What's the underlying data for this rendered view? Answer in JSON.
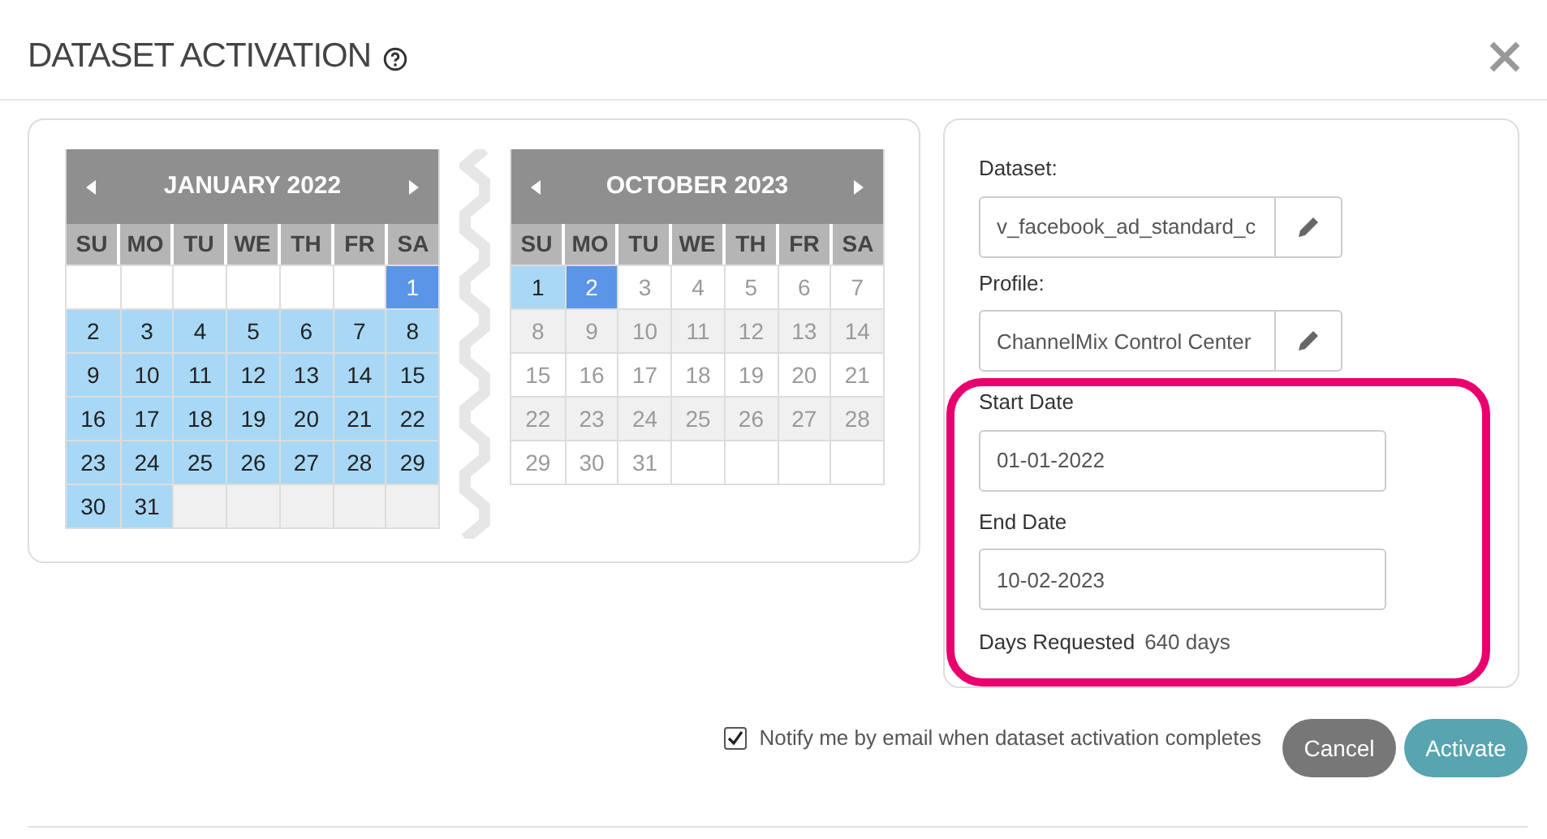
{
  "dialog": {
    "title": "DATASET ACTIVATION"
  },
  "calendars": [
    {
      "title": "JANUARY 2022",
      "weekdays": [
        "SU",
        "MO",
        "TU",
        "WE",
        "TH",
        "FR",
        "SA"
      ],
      "weeks": [
        [
          {
            "kind": "blank"
          },
          {
            "kind": "blank"
          },
          {
            "kind": "blank"
          },
          {
            "kind": "blank"
          },
          {
            "kind": "blank"
          },
          {
            "kind": "blank"
          },
          {
            "kind": "day",
            "day": "1",
            "selected": true,
            "in_range": false,
            "disabled": false
          }
        ],
        [
          {
            "kind": "day",
            "day": "2",
            "selected": false,
            "in_range": true,
            "disabled": false
          },
          {
            "kind": "day",
            "day": "3",
            "selected": false,
            "in_range": true,
            "disabled": false
          },
          {
            "kind": "day",
            "day": "4",
            "selected": false,
            "in_range": true,
            "disabled": false
          },
          {
            "kind": "day",
            "day": "5",
            "selected": false,
            "in_range": true,
            "disabled": false
          },
          {
            "kind": "day",
            "day": "6",
            "selected": false,
            "in_range": true,
            "disabled": false
          },
          {
            "kind": "day",
            "day": "7",
            "selected": false,
            "in_range": true,
            "disabled": false
          },
          {
            "kind": "day",
            "day": "8",
            "selected": false,
            "in_range": true,
            "disabled": false
          }
        ],
        [
          {
            "kind": "day",
            "day": "9",
            "selected": false,
            "in_range": true,
            "disabled": false
          },
          {
            "kind": "day",
            "day": "10",
            "selected": false,
            "in_range": true,
            "disabled": false
          },
          {
            "kind": "day",
            "day": "11",
            "selected": false,
            "in_range": true,
            "disabled": false
          },
          {
            "kind": "day",
            "day": "12",
            "selected": false,
            "in_range": true,
            "disabled": false
          },
          {
            "kind": "day",
            "day": "13",
            "selected": false,
            "in_range": true,
            "disabled": false
          },
          {
            "kind": "day",
            "day": "14",
            "selected": false,
            "in_range": true,
            "disabled": false
          },
          {
            "kind": "day",
            "day": "15",
            "selected": false,
            "in_range": true,
            "disabled": false
          }
        ],
        [
          {
            "kind": "day",
            "day": "16",
            "selected": false,
            "in_range": true,
            "disabled": false
          },
          {
            "kind": "day",
            "day": "17",
            "selected": false,
            "in_range": true,
            "disabled": false
          },
          {
            "kind": "day",
            "day": "18",
            "selected": false,
            "in_range": true,
            "disabled": false
          },
          {
            "kind": "day",
            "day": "19",
            "selected": false,
            "in_range": true,
            "disabled": false
          },
          {
            "kind": "day",
            "day": "20",
            "selected": false,
            "in_range": true,
            "disabled": false
          },
          {
            "kind": "day",
            "day": "21",
            "selected": false,
            "in_range": true,
            "disabled": false
          },
          {
            "kind": "day",
            "day": "22",
            "selected": false,
            "in_range": true,
            "disabled": false
          }
        ],
        [
          {
            "kind": "day",
            "day": "23",
            "selected": false,
            "in_range": true,
            "disabled": false
          },
          {
            "kind": "day",
            "day": "24",
            "selected": false,
            "in_range": true,
            "disabled": false
          },
          {
            "kind": "day",
            "day": "25",
            "selected": false,
            "in_range": true,
            "disabled": false
          },
          {
            "kind": "day",
            "day": "26",
            "selected": false,
            "in_range": true,
            "disabled": false
          },
          {
            "kind": "day",
            "day": "27",
            "selected": false,
            "in_range": true,
            "disabled": false
          },
          {
            "kind": "day",
            "day": "28",
            "selected": false,
            "in_range": true,
            "disabled": false
          },
          {
            "kind": "day",
            "day": "29",
            "selected": false,
            "in_range": true,
            "disabled": false
          }
        ],
        [
          {
            "kind": "day",
            "day": "30",
            "selected": false,
            "in_range": true,
            "disabled": false
          },
          {
            "kind": "day",
            "day": "31",
            "selected": false,
            "in_range": true,
            "disabled": false
          },
          {
            "kind": "blank"
          },
          {
            "kind": "blank"
          },
          {
            "kind": "blank"
          },
          {
            "kind": "blank"
          },
          {
            "kind": "blank"
          }
        ]
      ]
    },
    {
      "title": "OCTOBER 2023",
      "weekdays": [
        "SU",
        "MO",
        "TU",
        "WE",
        "TH",
        "FR",
        "SA"
      ],
      "weeks": [
        [
          {
            "kind": "day",
            "day": "1",
            "selected": false,
            "in_range": true,
            "disabled": false
          },
          {
            "kind": "day",
            "day": "2",
            "selected": true,
            "in_range": false,
            "disabled": false
          },
          {
            "kind": "day",
            "day": "3",
            "selected": false,
            "in_range": false,
            "disabled": true
          },
          {
            "kind": "day",
            "day": "4",
            "selected": false,
            "in_range": false,
            "disabled": true
          },
          {
            "kind": "day",
            "day": "5",
            "selected": false,
            "in_range": false,
            "disabled": true
          },
          {
            "kind": "day",
            "day": "6",
            "selected": false,
            "in_range": false,
            "disabled": true
          },
          {
            "kind": "day",
            "day": "7",
            "selected": false,
            "in_range": false,
            "disabled": true
          }
        ],
        [
          {
            "kind": "day",
            "day": "8",
            "selected": false,
            "in_range": false,
            "disabled": true
          },
          {
            "kind": "day",
            "day": "9",
            "selected": false,
            "in_range": false,
            "disabled": true
          },
          {
            "kind": "day",
            "day": "10",
            "selected": false,
            "in_range": false,
            "disabled": true
          },
          {
            "kind": "day",
            "day": "11",
            "selected": false,
            "in_range": false,
            "disabled": true
          },
          {
            "kind": "day",
            "day": "12",
            "selected": false,
            "in_range": false,
            "disabled": true
          },
          {
            "kind": "day",
            "day": "13",
            "selected": false,
            "in_range": false,
            "disabled": true
          },
          {
            "kind": "day",
            "day": "14",
            "selected": false,
            "in_range": false,
            "disabled": true
          }
        ],
        [
          {
            "kind": "day",
            "day": "15",
            "selected": false,
            "in_range": false,
            "disabled": true
          },
          {
            "kind": "day",
            "day": "16",
            "selected": false,
            "in_range": false,
            "disabled": true
          },
          {
            "kind": "day",
            "day": "17",
            "selected": false,
            "in_range": false,
            "disabled": true
          },
          {
            "kind": "day",
            "day": "18",
            "selected": false,
            "in_range": false,
            "disabled": true
          },
          {
            "kind": "day",
            "day": "19",
            "selected": false,
            "in_range": false,
            "disabled": true
          },
          {
            "kind": "day",
            "day": "20",
            "selected": false,
            "in_range": false,
            "disabled": true
          },
          {
            "kind": "day",
            "day": "21",
            "selected": false,
            "in_range": false,
            "disabled": true
          }
        ],
        [
          {
            "kind": "day",
            "day": "22",
            "selected": false,
            "in_range": false,
            "disabled": true
          },
          {
            "kind": "day",
            "day": "23",
            "selected": false,
            "in_range": false,
            "disabled": true
          },
          {
            "kind": "day",
            "day": "24",
            "selected": false,
            "in_range": false,
            "disabled": true
          },
          {
            "kind": "day",
            "day": "25",
            "selected": false,
            "in_range": false,
            "disabled": true
          },
          {
            "kind": "day",
            "day": "26",
            "selected": false,
            "in_range": false,
            "disabled": true
          },
          {
            "kind": "day",
            "day": "27",
            "selected": false,
            "in_range": false,
            "disabled": true
          },
          {
            "kind": "day",
            "day": "28",
            "selected": false,
            "in_range": false,
            "disabled": true
          }
        ],
        [
          {
            "kind": "day",
            "day": "29",
            "selected": false,
            "in_range": false,
            "disabled": true
          },
          {
            "kind": "day",
            "day": "30",
            "selected": false,
            "in_range": false,
            "disabled": true
          },
          {
            "kind": "day",
            "day": "31",
            "selected": false,
            "in_range": false,
            "disabled": true
          },
          {
            "kind": "blank"
          },
          {
            "kind": "blank"
          },
          {
            "kind": "blank"
          },
          {
            "kind": "blank"
          }
        ]
      ]
    }
  ],
  "dataset": {
    "label": "Dataset:",
    "value": "v_facebook_ad_standard_c"
  },
  "profile": {
    "label": "Profile:",
    "value": "ChannelMix Control Center"
  },
  "start_date": {
    "label": "Start Date",
    "value": "01-01-2022"
  },
  "end_date": {
    "label": "End Date",
    "value": "10-02-2023"
  },
  "days_requested": {
    "label": "Days Requested",
    "value": "640 days"
  },
  "notify": {
    "label": "Notify me by email when dataset activation completes",
    "checked": true
  },
  "buttons": [
    {
      "label": "Cancel",
      "kind": "secondary"
    },
    {
      "label": "Activate",
      "kind": "primary"
    }
  ]
}
